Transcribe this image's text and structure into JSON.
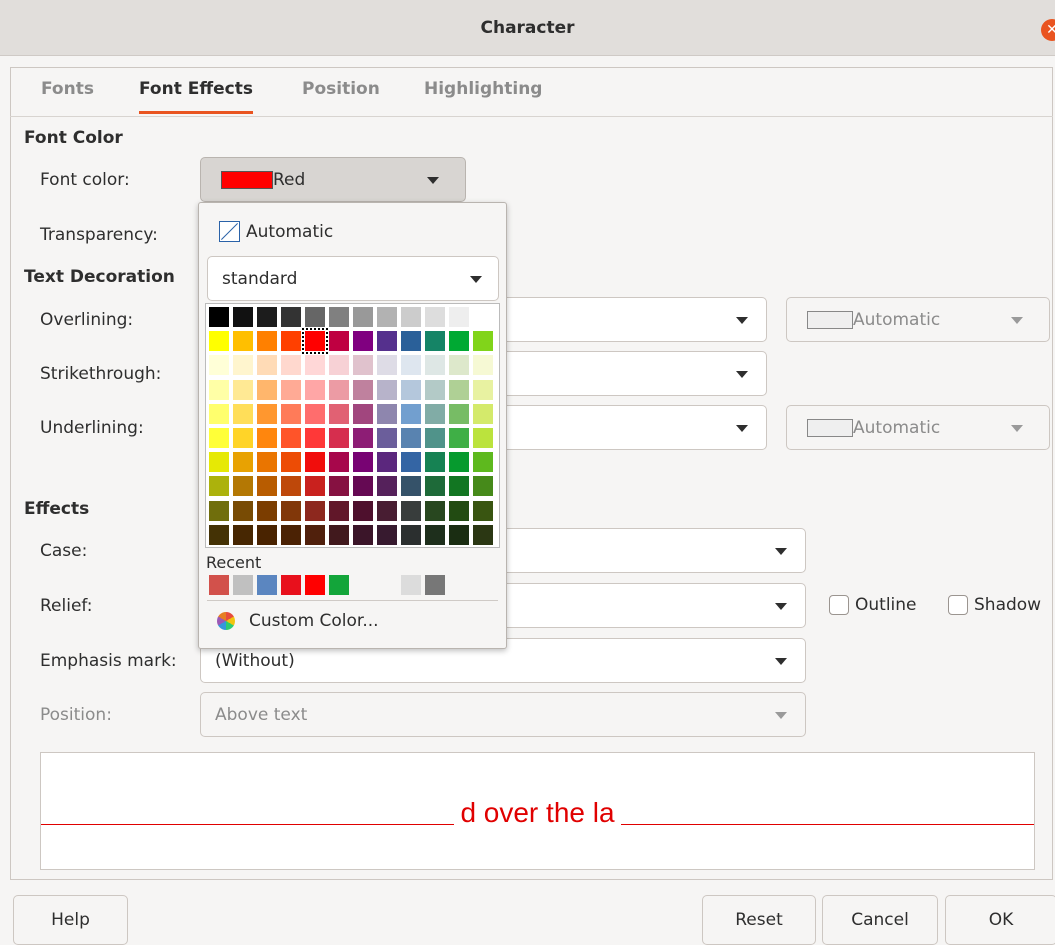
{
  "window": {
    "title": "Character"
  },
  "tabs": [
    "Fonts",
    "Font Effects",
    "Position",
    "Highlighting"
  ],
  "font_color": {
    "section": "Font Color",
    "label": "Font color:",
    "value": "Red",
    "value_color": "#ff0000",
    "transparency_label": "Transparency:"
  },
  "text_decoration": {
    "section": "Text Decoration",
    "overlining_label": "Overlining:",
    "overlining_color": "Automatic",
    "strikethrough_label": "Strikethrough:",
    "underlining_label": "Underlining:",
    "underlining_color": "Automatic"
  },
  "effects": {
    "section": "Effects",
    "case_label": "Case:",
    "relief_label": "Relief:",
    "outline_label": "Outline",
    "shadow_label": "Shadow",
    "emphasis_label": "Emphasis mark:",
    "emphasis_value": "(Without)",
    "position_label": "Position:",
    "position_value": "Above text"
  },
  "preview": {
    "text": "d over the la",
    "color": "#e00000"
  },
  "buttons": {
    "help": "Help",
    "reset": "Reset",
    "cancel": "Cancel",
    "ok": "OK"
  },
  "popup": {
    "automatic_label": "Automatic",
    "palette": "standard",
    "recent_label": "Recent",
    "custom_label": "Custom Color...",
    "selected_color": "#ff0000",
    "colors": [
      [
        "#000000",
        "#111111",
        "#1c1c1c",
        "#333333",
        "#666666",
        "#808080",
        "#999999",
        "#b2b2b2",
        "#cccccc",
        "#dddddd",
        "#eeeeee",
        "#ffffff"
      ],
      [
        "#ffff00",
        "#ffbf00",
        "#ff8000",
        "#ff4000",
        "#ff0000",
        "#bf0041",
        "#800080",
        "#55308d",
        "#2a6099",
        "#158466",
        "#00a933",
        "#81d41a"
      ],
      [
        "#ffffd7",
        "#fff5ce",
        "#ffdbb6",
        "#ffd8ce",
        "#ffd7d7",
        "#f7d1d5",
        "#e0c2cd",
        "#dedce6",
        "#dee6ef",
        "#dee7e5",
        "#dde8cb",
        "#f6f9d4"
      ],
      [
        "#ffffa6",
        "#ffe994",
        "#ffb66c",
        "#ffaa95",
        "#ffa6a6",
        "#ec9ba4",
        "#bf819e",
        "#b7b3ca",
        "#b4c7dc",
        "#b3cac7",
        "#afd095",
        "#e8f2a1"
      ],
      [
        "#ffff6d",
        "#ffde59",
        "#ff972f",
        "#ff7b59",
        "#ff6d6d",
        "#e16173",
        "#a1467e",
        "#8e86ae",
        "#729fcf",
        "#81aca6",
        "#77bc65",
        "#d4ea6b"
      ],
      [
        "#ffff38",
        "#ffd428",
        "#ff860d",
        "#ff5429",
        "#ff3838",
        "#d62e4e",
        "#8d1d75",
        "#6b5e9b",
        "#5983b0",
        "#50938a",
        "#3faf46",
        "#bbe33d"
      ],
      [
        "#e6e905",
        "#e8a202",
        "#ea7500",
        "#ed4c05",
        "#f10d0c",
        "#a7074b",
        "#780373",
        "#5b277d",
        "#3465a4",
        "#168253",
        "#069a2e",
        "#5eb91e"
      ],
      [
        "#acb20c",
        "#b47804",
        "#b85c00",
        "#be480a",
        "#c9211e",
        "#861141",
        "#650953",
        "#55215b",
        "#355269",
        "#1e6a39",
        "#127622",
        "#468a1a"
      ],
      [
        "#706e0c",
        "#784b04",
        "#7b3d00",
        "#813709",
        "#8d281e",
        "#611729",
        "#4e102d",
        "#481d32",
        "#383d3c",
        "#28471f",
        "#224b12",
        "#395511"
      ],
      [
        "#443205",
        "#472702",
        "#492300",
        "#4b2204",
        "#50200c",
        "#41191d",
        "#3b1529",
        "#371a2f",
        "#2b2f2f",
        "#1e2f1c",
        "#1a2d12",
        "#2b3713"
      ]
    ],
    "recent": [
      "#d2514b",
      "#c0c0c0",
      "#5b86c0",
      "#e8101c",
      "#ff0000",
      "#13a53a",
      "",
      "",
      "#dcdcdc",
      "#777777"
    ]
  }
}
